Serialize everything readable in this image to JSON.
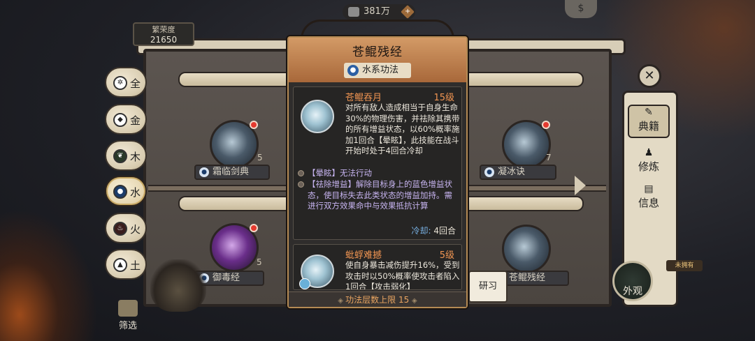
{
  "top_bar": {
    "prosperity_label": "繁荣度",
    "prosperity_value": "21650",
    "currency_amount": "381万",
    "currency_plus": "+"
  },
  "elements": [
    {
      "label": "全",
      "icon": "all-icon"
    },
    {
      "label": "金",
      "icon": "metal-icon"
    },
    {
      "label": "木",
      "icon": "wood-icon"
    },
    {
      "label": "水",
      "icon": "water-icon"
    },
    {
      "label": "火",
      "icon": "fire-icon"
    },
    {
      "label": "土",
      "icon": "earth-icon"
    }
  ],
  "books": [
    {
      "name": "霜临剑典",
      "count": "5"
    },
    {
      "name": "凝冰诀",
      "count": "7"
    },
    {
      "name": "御毒经",
      "count": "5"
    },
    {
      "name": "苍鲲残经",
      "count": ""
    }
  ],
  "right_tabs": {
    "classics": "典籍",
    "cultivate": "修炼",
    "info": "信息"
  },
  "buttons": {
    "appearance": "外观",
    "not_owned": "未拥有",
    "filter": "筛选",
    "research": "研习"
  },
  "popup": {
    "title": "苍鲲残经",
    "type": "水系功法",
    "skills": [
      {
        "name": "苍鲲吞月",
        "level": "15级",
        "desc": "对所有敌人造成相当于自身生命30%的物理伤害，并祛除其携带的所有增益状态，以60%概率施加1回合【晕眩】，此技能在战斗开始时处于4回合冷却",
        "effects": [
          "【晕眩】无法行动",
          "【祛除增益】解除目标身上的蓝色增益状态，使目标失去此类状态的增益加持。需进行双方效果命中与效果抵抗计算"
        ],
        "cooldown_label": "冷却:",
        "cooldown_value": "4回合"
      },
      {
        "name": "蚍蜉难撼",
        "level": "5级",
        "desc": "使自身暴击减伤提升16%，受到攻击时以50%概率使攻击者陷入1回合【攻击弱化】"
      }
    ],
    "footer": "功法层数上限 15"
  },
  "colors": {
    "accent_orange": "#f19552",
    "effect_purple": "#c7b4f0",
    "cooldown_blue": "#79b3e6",
    "popup_header": "#d39a66"
  }
}
